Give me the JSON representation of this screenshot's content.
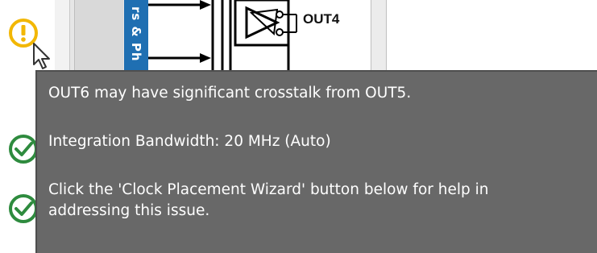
{
  "status_column": {
    "items": [
      {
        "status": "warning",
        "icon": "warning-circle-icon"
      },
      {
        "status": "ok",
        "icon": "check-circle-icon"
      },
      {
        "status": "ok",
        "icon": "check-circle-icon"
      }
    ]
  },
  "diagram": {
    "vertical_tab_label": "rs & Ph",
    "output_label": "OUT4"
  },
  "tooltip": {
    "line1": "OUT6 may have significant crosstalk from OUT5.",
    "line2": "Integration Bandwidth: 20 MHz (Auto)",
    "line3a": "Click the 'Clock Placement Wizard' button below for help in",
    "line3b": "addressing this issue."
  },
  "colors": {
    "warning": "#f2b705",
    "ok": "#2e8b3e",
    "tab_blue": "#1f6fb2",
    "tooltip_bg": "#686868"
  }
}
